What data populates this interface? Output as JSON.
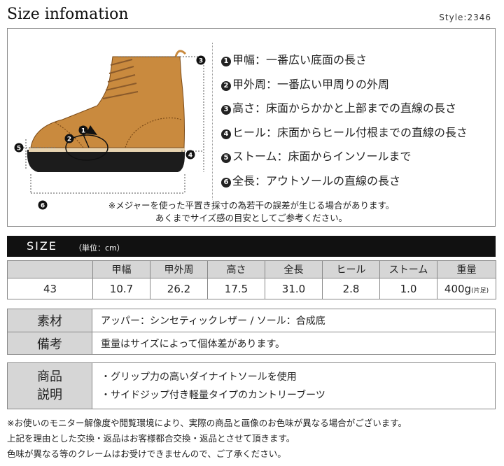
{
  "header": {
    "title": "Size infomation",
    "style": "Style:2346"
  },
  "legend": [
    {
      "num": "1",
      "text": "甲幅：一番広い底面の長さ"
    },
    {
      "num": "2",
      "text": "甲外周：一番広い甲周りの外周"
    },
    {
      "num": "3",
      "text": "高さ：床面からかかと上部までの直線の長さ"
    },
    {
      "num": "4",
      "text": "ヒール：床面からヒール付根までの直線の長さ"
    },
    {
      "num": "5",
      "text": "ストーム：床面からインソールまで"
    },
    {
      "num": "6",
      "text": "全長：アウトソールの直線の長さ"
    }
  ],
  "notes": [
    "※メジャーを使った平置き採寸の為若干の誤差が生じる場合があります。",
    "あくまでサイズ感の目安としてご参考ください。"
  ],
  "size": {
    "header": "SIZE",
    "unit": "（単位：cm）",
    "columns": [
      "甲幅",
      "甲外周",
      "高さ",
      "全長",
      "ヒール",
      "ストーム",
      "重量"
    ],
    "row": {
      "size": "43",
      "values": [
        "10.7",
        "26.2",
        "17.5",
        "31.0",
        "2.8",
        "1.0"
      ],
      "weight": "400g",
      "weight_note": "(片足)"
    }
  },
  "material": {
    "label": "素材",
    "text": "アッパー：シンセティックレザー / ソール：合成底"
  },
  "remarks": {
    "label": "備考",
    "text": "重量はサイズによって個体差があります。"
  },
  "product": {
    "label": "商品\n説明",
    "bullets": [
      "・グリップ力の高いダイナイトソールを使用",
      "・サイドジップ付き軽量タイプのカントリーブーツ"
    ]
  },
  "footer": [
    "※お使いのモニター解像度や閲覧環境により、実際の商品と画像のお色味が異なる場合がございます。",
    "上記を理由とした交換・返品はお客様都合交換・返品とさせて頂きます。",
    "色味が異なる等のクレームはお受けできませんので、ご了承ください。"
  ],
  "colors": {
    "boot_leather": "#c98a3e",
    "sole": "#1c1c1c",
    "header_bar": "#111111",
    "label_bg": "#d6d6d6"
  }
}
